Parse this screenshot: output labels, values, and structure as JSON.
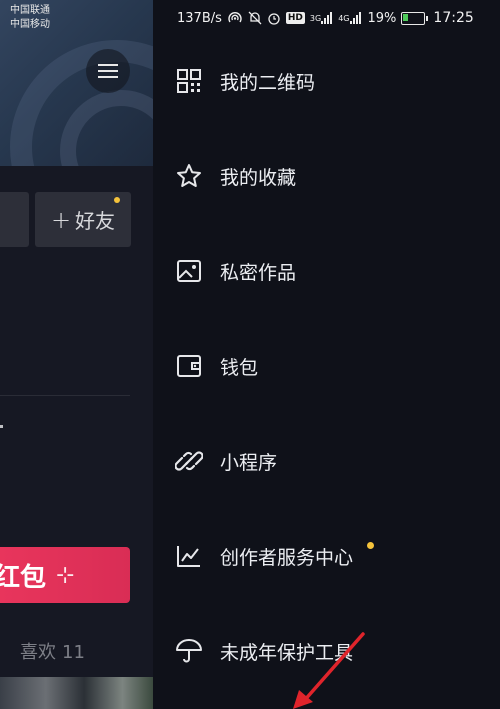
{
  "status_bar": {
    "carrier_1": "中国联通",
    "carrier_2": "中国移动",
    "net_speed": "137B/s",
    "signal_1": "3G",
    "signal_2": "4G",
    "battery": "19%",
    "time": "17:25"
  },
  "profile": {
    "add_friend_label": "好友",
    "banner_text": "红包",
    "likes_label": "喜欢",
    "likes_count": "11"
  },
  "menu": {
    "items": [
      {
        "label": "我的二维码",
        "icon": "qr-code-icon"
      },
      {
        "label": "我的收藏",
        "icon": "star-icon"
      },
      {
        "label": "私密作品",
        "icon": "image-icon"
      },
      {
        "label": "钱包",
        "icon": "wallet-icon"
      },
      {
        "label": "小程序",
        "icon": "link-icon"
      },
      {
        "label": "创作者服务中心",
        "icon": "chart-icon"
      },
      {
        "label": "未成年保护工具",
        "icon": "umbrella-icon"
      }
    ]
  },
  "colors": {
    "background": "#0f1119",
    "accent_dot": "#f5c33b",
    "banner": "#e8355c",
    "annotation_arrow": "#e0242b"
  }
}
